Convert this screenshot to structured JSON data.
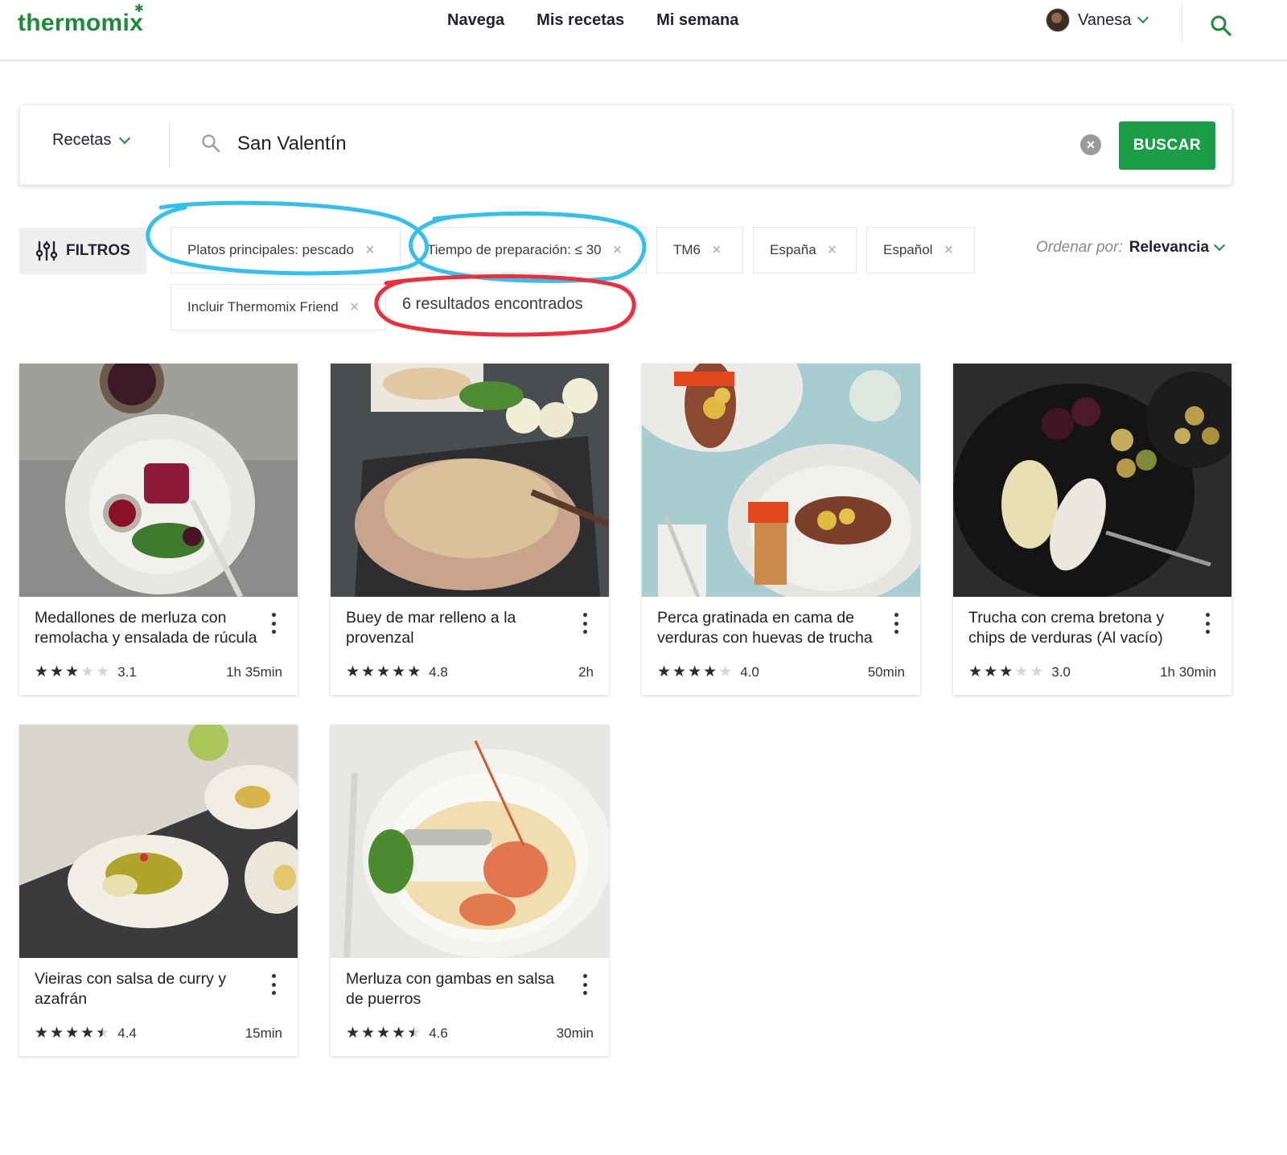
{
  "header": {
    "logo": "thermomix",
    "nav": [
      "Navega",
      "Mis recetas",
      "Mi semana"
    ],
    "user_name": "Vanesa",
    "brand_color": "#1e8a3b"
  },
  "search": {
    "scope_label": "Recetas",
    "query": "San Valentín",
    "button_label": "BUSCAR",
    "button_color": "#1a9e45"
  },
  "filters": {
    "toggle_label": "FILTROS",
    "chips": [
      "Platos principales: pescado",
      "Tiempo de preparación: ≤ 30",
      "TM6",
      "España",
      "Español",
      "Incluir Thermomix Friend"
    ],
    "results_text": "6 resultados encontrados",
    "order_label": "Ordenar por:",
    "order_value": "Relevancia"
  },
  "annotations": {
    "blue_color": "#33c0ea",
    "red_color": "#ec2f3b"
  },
  "recipes": [
    {
      "title": "Medallones de merluza con remolacha y ensalada de rúcula",
      "rating": 3.1,
      "rating_text": "3.1",
      "time": "1h 35min"
    },
    {
      "title": "Buey de mar relleno a la provenzal",
      "rating": 4.8,
      "rating_text": "4.8",
      "time": "2h"
    },
    {
      "title": "Perca gratinada en cama de verduras con huevas de trucha",
      "rating": 4.0,
      "rating_text": "4.0",
      "time": "50min"
    },
    {
      "title": "Trucha con crema bretona y chips de verduras (Al vacío)",
      "rating": 3.0,
      "rating_text": "3.0",
      "time": "1h 30min"
    },
    {
      "title": "Vieiras con salsa de curry y azafrán",
      "rating": 4.4,
      "rating_text": "4.4",
      "time": "15min"
    },
    {
      "title": "Merluza con gambas en salsa de puerros",
      "rating": 4.6,
      "rating_text": "4.6",
      "time": "30min"
    }
  ]
}
